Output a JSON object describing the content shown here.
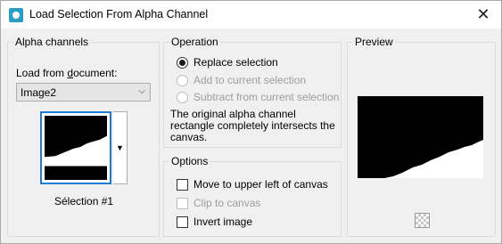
{
  "window": {
    "title": "Load Selection From Alpha Channel",
    "close_glyph": "✕",
    "icon": "app-icon"
  },
  "alpha": {
    "group_label": "Alpha channels",
    "load_from_label": "Load from document:",
    "document_value": "Image2",
    "selection_name": "Sélection #1"
  },
  "operation": {
    "group_label": "Operation",
    "options": [
      {
        "label": "Replace selection",
        "selected": true,
        "enabled": true
      },
      {
        "label": "Add to current selection",
        "selected": false,
        "enabled": false
      },
      {
        "label": "Subtract from current selection",
        "selected": false,
        "enabled": false
      }
    ],
    "description": "The original alpha channel rectangle completely intersects the canvas."
  },
  "options": {
    "group_label": "Options",
    "items": [
      {
        "label": "Move to upper left of canvas",
        "checked": false,
        "enabled": true
      },
      {
        "label": "Clip to canvas",
        "checked": false,
        "enabled": false
      },
      {
        "label": "Invert image",
        "checked": false,
        "enabled": true
      }
    ]
  },
  "preview": {
    "group_label": "Preview"
  },
  "colors": {
    "accent": "#1c7cd6",
    "app_icon": "#2b9cc4"
  }
}
